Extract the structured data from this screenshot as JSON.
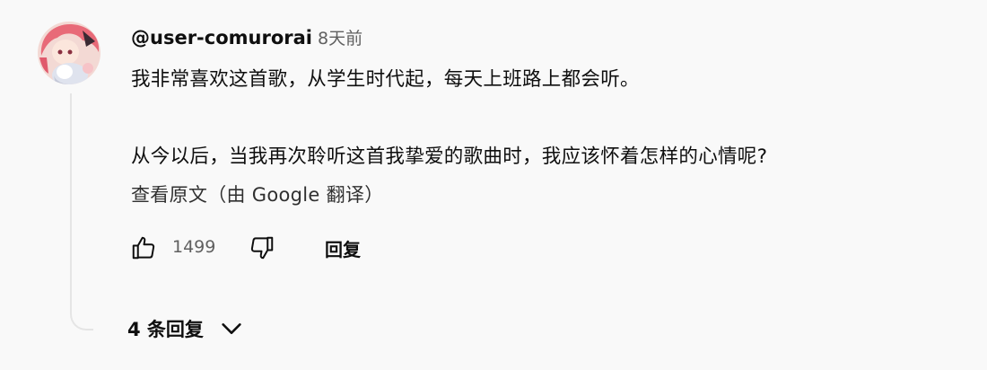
{
  "comment": {
    "username": "@user-comurorai",
    "timestamp": "8天前",
    "text_line_1": "我非常喜欢这首歌，从学生时代起，每天上班路上都会听。",
    "text_line_2": "从今以后，当我再次聆听这首我挚爱的歌曲时，我应该怀着怎样的心情呢?",
    "translate_link": "查看原文（由 Google 翻译）",
    "like_count": "1499",
    "reply_label": "回复",
    "replies_toggle_label": "4 条回复"
  },
  "icons": {
    "like": "thumbs-up-icon",
    "dislike": "thumbs-down-icon",
    "expand": "chevron-down-icon"
  },
  "colors": {
    "primary_text": "#0f0f0f",
    "secondary_text": "#606060",
    "background": "#f9f9f9"
  }
}
